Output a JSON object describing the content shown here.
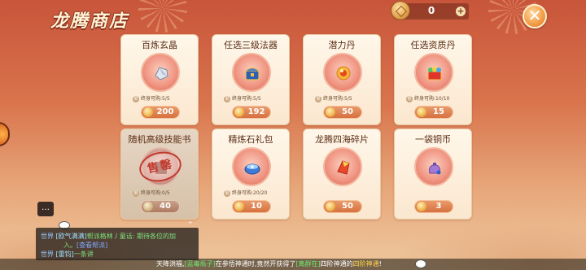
{
  "shop": {
    "title": "龙腾商店"
  },
  "currency": {
    "amount": "0",
    "icon": "coin-icon",
    "add": "+"
  },
  "close": {
    "glyph": "✕"
  },
  "colors": {
    "accent": "#d7713f",
    "card": "#fff7ea",
    "sold_stamp": "#c13b30"
  },
  "items": [
    {
      "name": "百炼玄晶",
      "limit_label": "终身可购:",
      "limit": "5/5",
      "price": "200",
      "icon": "crystal-icon"
    },
    {
      "name": "任选三级法器",
      "limit_label": "终身可购:",
      "limit": "5/5",
      "price": "192",
      "icon": "chest-icon"
    },
    {
      "name": "潜力丹",
      "limit_label": "终身可购:",
      "limit": "5/5",
      "price": "50",
      "icon": "pill-icon"
    },
    {
      "name": "任选资质丹",
      "limit_label": "终身可购:",
      "limit": "10/10",
      "price": "15",
      "icon": "gift-box-icon"
    },
    {
      "name": "随机高级技能书",
      "limit_label": "终身可购:",
      "limit": "0/5",
      "price": "40",
      "icon": "skill-book-icon",
      "sold_out": true,
      "stamp": "售罄"
    },
    {
      "name": "精炼石礼包",
      "limit_label": "终身可购:",
      "limit": "20/20",
      "price": "10",
      "icon": "stone-pack-icon"
    },
    {
      "name": "龙腾四海碎片",
      "limit_label": "",
      "limit": "",
      "price": "50",
      "icon": "fragment-icon"
    },
    {
      "name": "一袋铜币",
      "limit_label": "",
      "limit": "",
      "price": "3",
      "icon": "coin-bag-icon"
    }
  ],
  "chat": {
    "button_glyph": "…",
    "collapse": "⌃",
    "lines": [
      {
        "channel": "世界",
        "user": "[欧气满满]",
        "text_green": "帮派格林丿童话:",
        "text_white": "期待各位的加",
        "text_white2": "入。",
        "link": "[查看帮派]"
      },
      {
        "channel": "世界",
        "user": "[雷钧]",
        "text_green": "一条讲",
        "text_white": "",
        "text_white2": "",
        "link": ""
      }
    ]
  },
  "ticker": {
    "prefix": "天降洪福,",
    "name": "[蓝毒瓶子]",
    "mid": "在参悟神通时,竟然开获得了",
    "item": "[离群在]",
    "mid2": "四阶神通的",
    "item2": "四阶神通",
    "suffix": "!"
  }
}
